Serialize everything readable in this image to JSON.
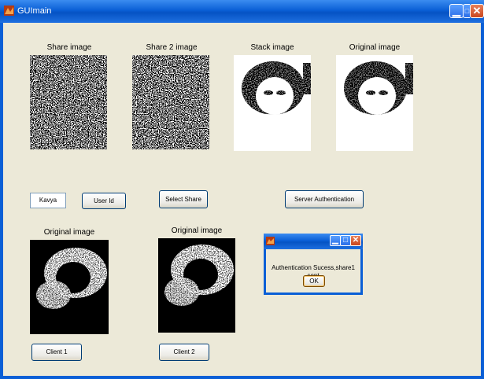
{
  "window": {
    "title": "GUImain",
    "icons": {
      "app": "matlab-icon",
      "minimize": "minimize-icon",
      "maximize": "maximize-icon",
      "close": "close-icon"
    }
  },
  "panels": {
    "share1": {
      "label": "Share image"
    },
    "share2": {
      "label": "Share 2 image"
    },
    "stack": {
      "label": "Stack image"
    },
    "original": {
      "label": "Original image"
    },
    "client1_image": {
      "label": "Original image"
    },
    "client2_image": {
      "label": "Original image"
    }
  },
  "inputs": {
    "user_field": {
      "value": "Kavya"
    }
  },
  "buttons": {
    "user_id": "User Id",
    "select_share": "Select Share",
    "server_auth": "Server Authentication",
    "client1": "Client 1",
    "client2": "Client 2"
  },
  "dialog": {
    "message": "Authentication Sucess,share1 sent",
    "ok_label": "OK"
  },
  "colors": {
    "window_bg": "#ece9d8",
    "titlebar": "#0a5fd6",
    "button_border": "#003c74"
  }
}
